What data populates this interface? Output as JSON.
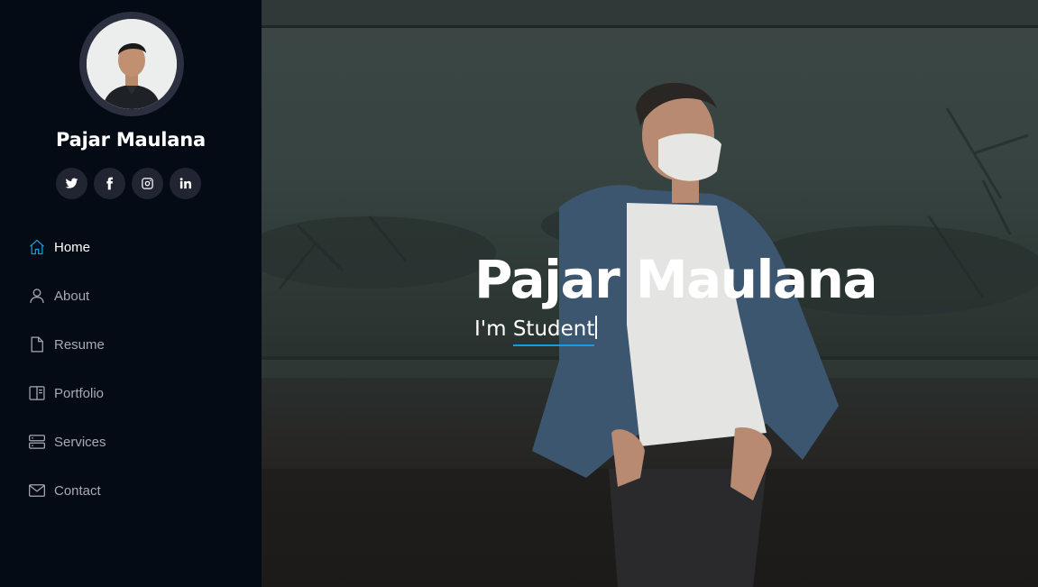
{
  "profile": {
    "name": "Pajar Maulana"
  },
  "social": [
    {
      "icon": "twitter-icon"
    },
    {
      "icon": "facebook-icon"
    },
    {
      "icon": "instagram-icon"
    },
    {
      "icon": "linkedin-icon"
    }
  ],
  "nav": {
    "items": [
      {
        "label": "Home",
        "icon": "home-icon",
        "active": true
      },
      {
        "label": "About",
        "icon": "person-icon",
        "active": false
      },
      {
        "label": "Resume",
        "icon": "file-icon",
        "active": false
      },
      {
        "label": "Portfolio",
        "icon": "layout-icon",
        "active": false
      },
      {
        "label": "Services",
        "icon": "server-icon",
        "active": false
      },
      {
        "label": "Contact",
        "icon": "envelope-icon",
        "active": false
      }
    ]
  },
  "hero": {
    "title": "Pajar Maulana",
    "prefix": "I'm ",
    "typed": "Student"
  },
  "colors": {
    "accent": "#149ddd",
    "sidebar_bg": "#040b14",
    "nav_text": "#a8a9b4"
  }
}
